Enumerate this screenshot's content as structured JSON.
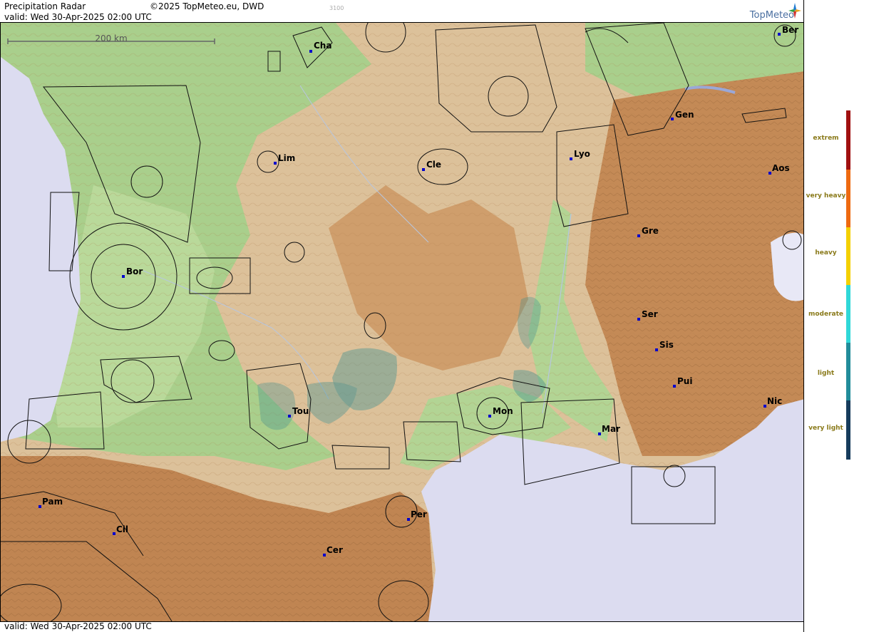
{
  "header": {
    "title": "Precipitation Radar",
    "copyright": "©2025 TopMeteo.eu, DWD",
    "valid": "valid:  Wed  30-Apr-2025 02:00 UTC",
    "small_code": "3100",
    "logo_text": "TopMeteo"
  },
  "map": {
    "scale_label": "200 km",
    "cities": [
      "Cha",
      "Ber",
      "Gen",
      "Lim",
      "Cle",
      "Lyo",
      "Aos",
      "Gre",
      "Bor",
      "Ser",
      "Sis",
      "Pui",
      "Tou",
      "Mon",
      "Mar",
      "Nic",
      "Pam",
      "Per",
      "Cil",
      "Cer"
    ],
    "colors": {
      "sea": "#dcdcf0",
      "lowland": "#a8cf8a",
      "hills": "#d8b890",
      "mountains": "#c48a56",
      "radar_echo": "#3f8f8f",
      "city_marker": "#0000cc"
    }
  },
  "legend": {
    "labels": [
      "extrem",
      "very heavy",
      "heavy",
      "moderate",
      "light",
      "very light"
    ],
    "colors": [
      "#a01010",
      "#ee6a10",
      "#f4d000",
      "#30d8d8",
      "#228c9a",
      "#163c5c"
    ],
    "label_color": "#8a7a1a"
  },
  "footer": {
    "valid": "valid:  Wed  30-Apr-2025 02:00 UTC"
  }
}
